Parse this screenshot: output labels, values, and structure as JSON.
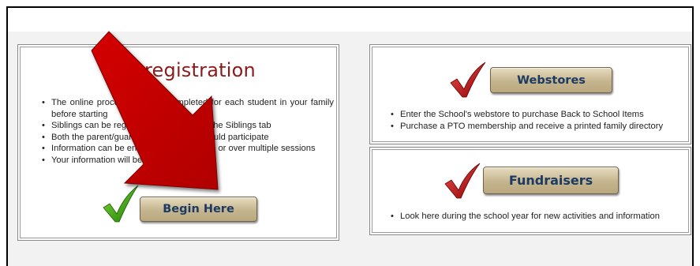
{
  "registration": {
    "title": "registration",
    "bullets": [
      "The online process must be completed for each student in your family before starting",
      "Siblings can be registered by clicking on the Siblings tab",
      "Both the parent/guardian and student should participate",
      "Information can be entered in one session or over multiple sessions",
      "Your information will be saved"
    ],
    "button_label": "Begin Here"
  },
  "webstores": {
    "button_label": "Webstores",
    "bullets": [
      "Enter the School's webstore to purchase Back to School Items",
      "Purchase a PTO membership and receive a printed family directory"
    ]
  },
  "fundraisers": {
    "button_label": "Fundraisers",
    "bullets": [
      "Look here during the school year for new activities and information"
    ]
  },
  "colors": {
    "title_red": "#8b1a1a",
    "button_text": "#1c3a63",
    "button_gold": "#c5b58e",
    "check_green": "#3aa00f",
    "check_red": "#c01010",
    "arrow_red": "#c60000"
  },
  "icons": {
    "green_check": "checkmark-icon",
    "red_check": "checkmark-icon",
    "pointer": "arrow-annotation-icon"
  }
}
